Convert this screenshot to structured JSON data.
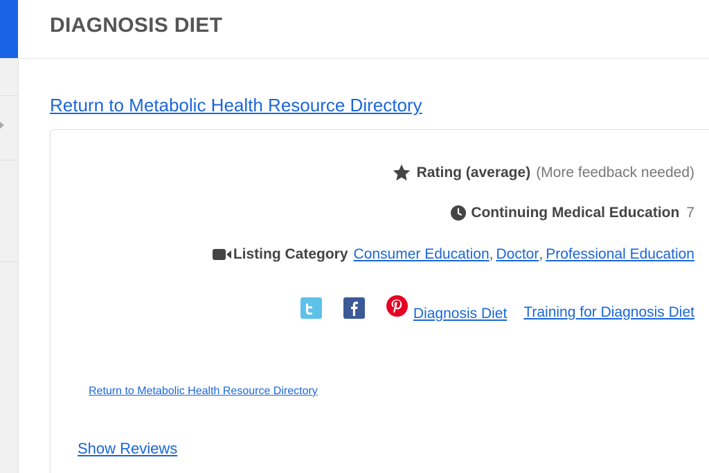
{
  "header": {
    "title": "DIAGNOSIS DIET"
  },
  "links": {
    "return_directory": "Return to Metabolic Health Resource Directory",
    "return_directory_small": "Return to Metabolic Health Resource Directory",
    "show_reviews": "Show Reviews"
  },
  "listing": {
    "rating_label": "Rating (average)",
    "rating_value": "(More feedback needed)",
    "cme_label": "Continuing Medical Education",
    "cme_value": "7",
    "category_label": "Listing Category",
    "categories": [
      "Consumer Education",
      "Doctor",
      "Professional Education"
    ],
    "category_separator": ","
  },
  "social": {
    "icons": [
      "twitter-icon",
      "facebook-icon",
      "pinterest-icon"
    ],
    "site_link": "Diagnosis Diet",
    "training_link": "Training for Diagnosis Diet"
  },
  "colors": {
    "accent": "#1a63e6",
    "link": "#1a66d9",
    "twitter": "#5ec1ea",
    "facebook": "#3b5998",
    "pinterest": "#e60023"
  }
}
